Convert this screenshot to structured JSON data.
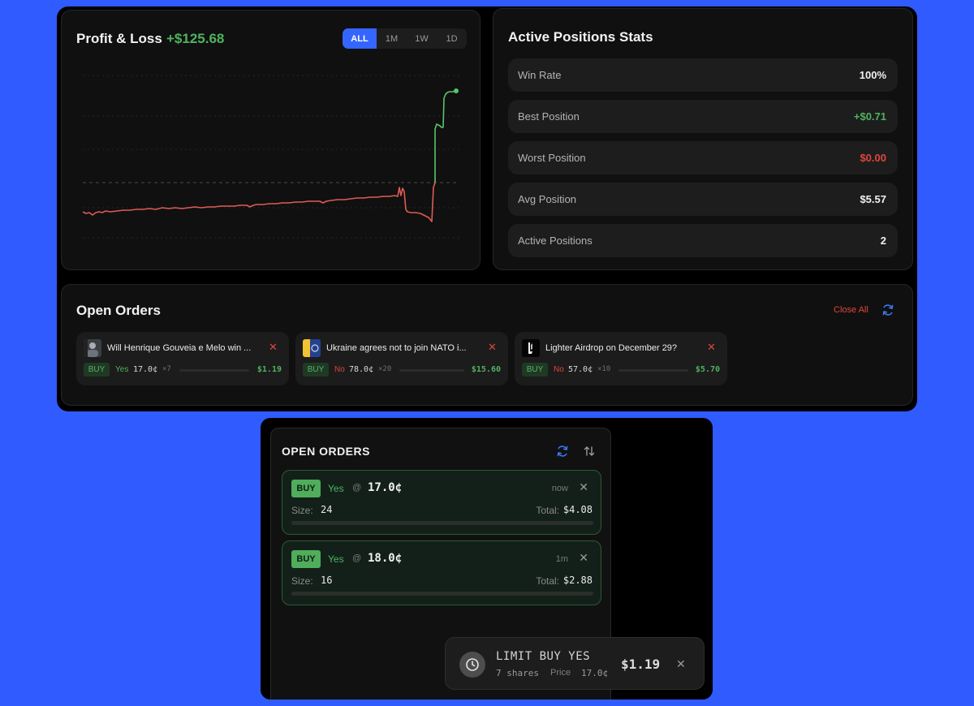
{
  "pnl": {
    "title": "Profit & Loss",
    "value": "+$125.68",
    "ranges": [
      "ALL",
      "1M",
      "1W",
      "1D"
    ],
    "active_range": "ALL"
  },
  "stats": {
    "title": "Active Positions Stats",
    "rows": [
      {
        "label": "Win Rate",
        "value": "100%",
        "tone": "neutral"
      },
      {
        "label": "Best Position",
        "value": "+$0.71",
        "tone": "green"
      },
      {
        "label": "Worst Position",
        "value": "$0.00",
        "tone": "red"
      },
      {
        "label": "Avg Position",
        "value": "$5.57",
        "tone": "neutral"
      },
      {
        "label": "Active Positions",
        "value": "2",
        "tone": "neutral"
      }
    ]
  },
  "open_orders": {
    "title": "Open Orders",
    "close_all": "Close All",
    "items": [
      {
        "title": "Will Henrique Gouveia e Melo win ...",
        "type": "BUY",
        "side": "Yes",
        "price": "17.0¢",
        "qty": "×7",
        "total": "$1.19",
        "progress": 0
      },
      {
        "title": "Ukraine agrees not to join NATO i...",
        "type": "BUY",
        "side": "No",
        "price": "78.0¢",
        "qty": "×20",
        "total": "$15.60",
        "progress": 0
      },
      {
        "title": "Lighter Airdrop on December 29?",
        "type": "BUY",
        "side": "No",
        "price": "57.0¢",
        "qty": "×10",
        "total": "$5.70",
        "progress": 0
      }
    ]
  },
  "side_panel": {
    "title": "OPEN ORDERS",
    "size_label": "Size:",
    "total_label": "Total:",
    "orders": [
      {
        "type": "BUY",
        "side": "Yes",
        "at": "@",
        "price": "17.0¢",
        "time": "now",
        "size": "24",
        "total": "$4.08",
        "progress": 0
      },
      {
        "type": "BUY",
        "side": "Yes",
        "at": "@",
        "price": "18.0¢",
        "time": "1m",
        "size": "16",
        "total": "$2.88",
        "progress": 0
      }
    ]
  },
  "toast": {
    "title": "LIMIT BUY YES",
    "shares": "7 shares",
    "price_label": "Price",
    "price": "17.0¢",
    "amount": "$1.19"
  },
  "colors": {
    "accent": "#3565ff",
    "green": "#4fb35f",
    "red": "#e0453e",
    "background": "#2f5bff"
  },
  "icons": {
    "refresh": "refresh-icon",
    "sort": "sort-arrows-icon",
    "close": "close-icon",
    "clock": "clock-icon"
  }
}
